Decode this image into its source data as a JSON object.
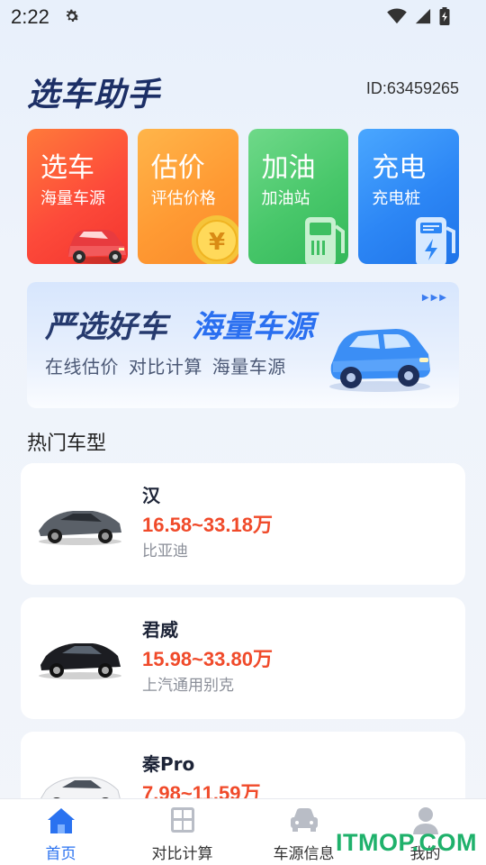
{
  "status_bar": {
    "time": "2:22",
    "icons": [
      "gear-icon",
      "wifi-icon",
      "signal-icon",
      "battery-icon"
    ]
  },
  "header": {
    "logo_text": "选车助手",
    "user_id": "ID:63459265"
  },
  "tiles": [
    {
      "title": "选车",
      "subtitle": "海量车源",
      "icon": "car-icon",
      "color": "#f7483a"
    },
    {
      "title": "估价",
      "subtitle": "评估价格",
      "icon": "coin-icon",
      "color": "#ff9d35"
    },
    {
      "title": "加油",
      "subtitle": "加油站",
      "icon": "fuel-pump-icon",
      "color": "#46c66a"
    },
    {
      "title": "充电",
      "subtitle": "充电桩",
      "icon": "charging-station-icon",
      "color": "#2c86f5"
    }
  ],
  "banner": {
    "title_a": "严选好车",
    "title_b": "海量车源",
    "subtitle": "在线估价 对比计算 海量车源",
    "arrows": "▶▶▶"
  },
  "section": {
    "title": "热门车型"
  },
  "cars": [
    {
      "name": "汉",
      "price": "16.58~33.18万",
      "brand": "比亚迪",
      "color": "#5a6068"
    },
    {
      "name": "君威",
      "price": "15.98~33.80万",
      "brand": "上汽通用别克",
      "color": "#1c1d22"
    },
    {
      "name": "秦Pro",
      "price": "7.98~11.59万",
      "brand": "",
      "color": "#f3f4f6"
    }
  ],
  "nav": {
    "items": [
      {
        "label": "首页",
        "icon": "home-icon",
        "active": true
      },
      {
        "label": "对比计算",
        "icon": "calculator-icon",
        "active": false
      },
      {
        "label": "车源信息",
        "icon": "car-icon",
        "active": false
      },
      {
        "label": "我的",
        "icon": "person-icon",
        "active": false
      }
    ]
  },
  "watermark": "ITMOP.COM",
  "colors": {
    "accent": "#2a72f0",
    "price": "#f04a2a",
    "dark_text": "#1d2437"
  }
}
